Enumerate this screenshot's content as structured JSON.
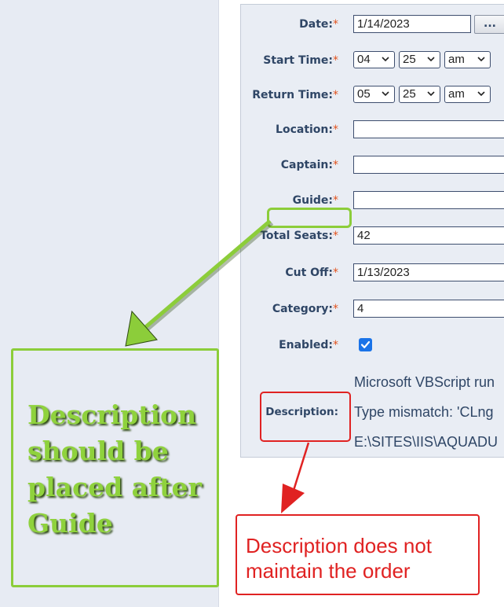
{
  "form": {
    "date": {
      "label": "Date:",
      "value": "1/14/2023",
      "browse_label": "..."
    },
    "start_time": {
      "label": "Start Time:",
      "hour": "04",
      "minute": "25",
      "ampm": "am"
    },
    "return_time": {
      "label": "Return Time:",
      "hour": "05",
      "minute": "25",
      "ampm": "am"
    },
    "location": {
      "label": "Location:",
      "value": ""
    },
    "captain": {
      "label": "Captain:",
      "value": ""
    },
    "guide": {
      "label": "Guide:",
      "value": ""
    },
    "total_seats": {
      "label": "Total Seats:",
      "value": "42"
    },
    "cut_off": {
      "label": "Cut Off:",
      "value": "1/13/2023"
    },
    "category": {
      "label": "Category:",
      "value": "4"
    },
    "enabled": {
      "label": "Enabled:",
      "checked": true
    },
    "description": {
      "label": "Description:",
      "lines": [
        "Microsoft VBScript run",
        "Type mismatch: 'CLng",
        "E:\\SITES\\IIS\\AQUADU"
      ]
    },
    "required_marker": "*"
  },
  "annotations": {
    "green_note": "Description should be placed after Guide",
    "red_note": "Description does not maintain the order"
  },
  "colors": {
    "label_text": "#2f4666",
    "required": "#e2541f",
    "green_annotation": "#8ccd3a",
    "red_annotation": "#e02222",
    "checkbox": "#1a73e8"
  },
  "icons": [
    "chevron-down-icon",
    "checkmark-icon",
    "arrow-icon"
  ]
}
